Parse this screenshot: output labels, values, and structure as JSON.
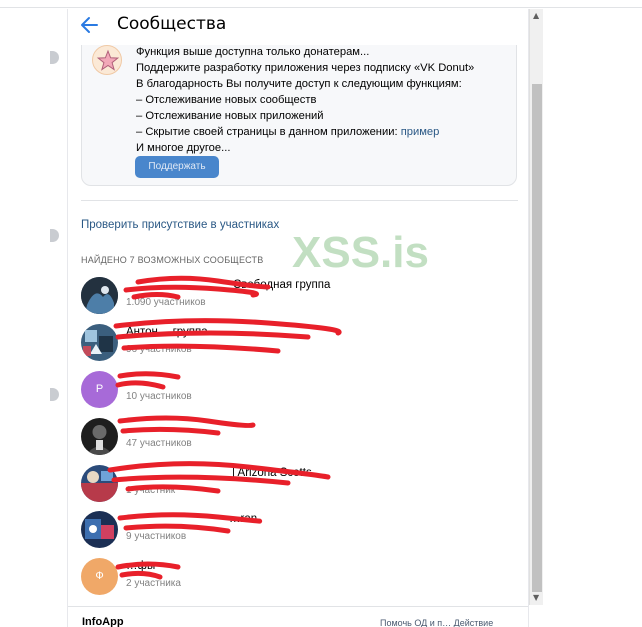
{
  "header": {
    "title": "Сообщества"
  },
  "donut_notice": {
    "lines": [
      "Функция выше доступна только донатерам...",
      "Поддержите разработку приложения через подписку «VK Donut»",
      "В благодарность Вы получите доступ к следующим функциям:",
      "– Отслеживание новых сообществ",
      "– Отслеживание новых приложений",
      "– Скрытие своей страницы в данном приложении: ",
      "И многое другое..."
    ],
    "example_link": "пример",
    "support_button": "Поддержать"
  },
  "check_presence_link": "Проверить присутствие в участниках",
  "found_label": "НАЙДЕНО 7 ВОЗМОЖНЫХ СООБЩЕСТВ",
  "watermark": "XSS.is",
  "groups": [
    {
      "name": "Свободная группа",
      "members": "1.090 участников"
    },
    {
      "name": "Антон… группа",
      "members": "96 участников"
    },
    {
      "name": "",
      "members": "10 участников",
      "avatar_letter": "Р"
    },
    {
      "name": "",
      "members": "47 участников"
    },
    {
      "name": "| Arizona Scotts",
      "members": "1 участник"
    },
    {
      "name": "…ran",
      "members": "9 участников"
    },
    {
      "name": "…фы",
      "members": "2 участника",
      "avatar_letter": "Ф"
    }
  ],
  "footer": {
    "app_name": "InfoApp",
    "links": "Помочь ОД и п… Действие"
  },
  "colors": {
    "accent": "#2a5885",
    "button": "#4986cc",
    "redaction": "#e8202a"
  }
}
